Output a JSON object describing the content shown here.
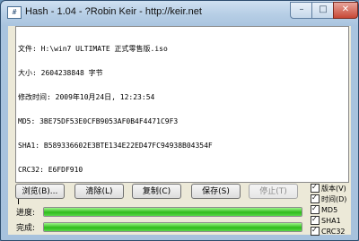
{
  "window": {
    "title": "Hash - 1.04 - ?Robin Keir - http://keir.net",
    "app_icon": "hash-app-icon",
    "controls": {
      "minimize": "–",
      "maximize": "□",
      "close": "✕"
    }
  },
  "output": {
    "lines": [
      "文件: H:\\win7 ULTIMATE 正式零售版.iso",
      "大小: 2604238848 字节",
      "修改时间: 2009年10月24日, 12:23:54",
      "MD5: 3BE75DF53E0CFB9053AF0B4F4471C9F3",
      "SHA1: B589336602E3BTE134E22ED47FC94938B04354F",
      "CRC32: E6FDF910"
    ]
  },
  "buttons": {
    "browse": "浏览(B)...",
    "clear": "清除(L)",
    "copy": "复制(C)",
    "save": "保存(S)",
    "stop": "停止(T)"
  },
  "progress": {
    "progress_label": "进度:",
    "progress_value": 100,
    "complete_label": "完成:",
    "complete_value": 100
  },
  "options": [
    {
      "label": "版本(V)",
      "checked": true
    },
    {
      "label": "时间(D)",
      "checked": true
    },
    {
      "label": "MD5",
      "checked": true
    },
    {
      "label": "SHA1",
      "checked": true
    },
    {
      "label": "CRC32",
      "checked": true
    }
  ]
}
